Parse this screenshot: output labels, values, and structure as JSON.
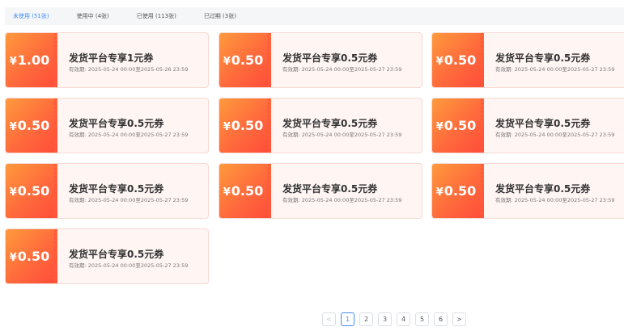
{
  "tabs": [
    {
      "label": "未使用 (51张)",
      "active": true
    },
    {
      "label": "使用中 (4张)",
      "active": false
    },
    {
      "label": "已使用 (113张)",
      "active": false
    },
    {
      "label": "已过期 (3张)",
      "active": false
    }
  ],
  "coupons": [
    {
      "currency": "¥",
      "amount": "1.00",
      "title": "发货平台专享1元券",
      "validity": "有效期: 2025-05-24 00:00至2025-05-26 23:59"
    },
    {
      "currency": "¥",
      "amount": "0.50",
      "title": "发货平台专享0.5元券",
      "validity": "有效期: 2025-05-24 00:00至2025-05-27 23:59"
    },
    {
      "currency": "¥",
      "amount": "0.50",
      "title": "发货平台专享0.5元券",
      "validity": "有效期: 2025-05-24 00:00至2025-05-27 23:59"
    },
    {
      "currency": "¥",
      "amount": "0.50",
      "title": "发货平台专享0.5元券",
      "validity": "有效期: 2025-05-24 00:00至2025-05-27 23:59"
    },
    {
      "currency": "¥",
      "amount": "0.50",
      "title": "发货平台专享0.5元券",
      "validity": "有效期: 2025-05-24 00:00至2025-05-27 23:59"
    },
    {
      "currency": "¥",
      "amount": "0.50",
      "title": "发货平台专享0.5元券",
      "validity": "有效期: 2025-05-24 00:00至2025-05-27 23:59"
    },
    {
      "currency": "¥",
      "amount": "0.50",
      "title": "发货平台专享0.5元券",
      "validity": "有效期: 2025-05-24 00:00至2025-05-27 23:59"
    },
    {
      "currency": "¥",
      "amount": "0.50",
      "title": "发货平台专享0.5元券",
      "validity": "有效期: 2025-05-24 00:00至2025-05-27 23:59"
    },
    {
      "currency": "¥",
      "amount": "0.50",
      "title": "发货平台专享0.5元券",
      "validity": "有效期: 2025-05-24 00:00至2025-05-27 23:59"
    },
    {
      "currency": "¥",
      "amount": "0.50",
      "title": "发货平台专享0.5元券",
      "validity": "有效期: 2025-05-24 00:00至2025-05-27 23:59"
    }
  ],
  "pagination": {
    "prev": "<",
    "next": ">",
    "pages": [
      "1",
      "2",
      "3",
      "4",
      "5",
      "6"
    ],
    "current": "1"
  },
  "colors": {
    "accent": "#3e8ef7",
    "coupon_gradient_start": "#ff9b3d",
    "coupon_gradient_end": "#ff4b3a",
    "coupon_bg": "#fff6f4"
  }
}
